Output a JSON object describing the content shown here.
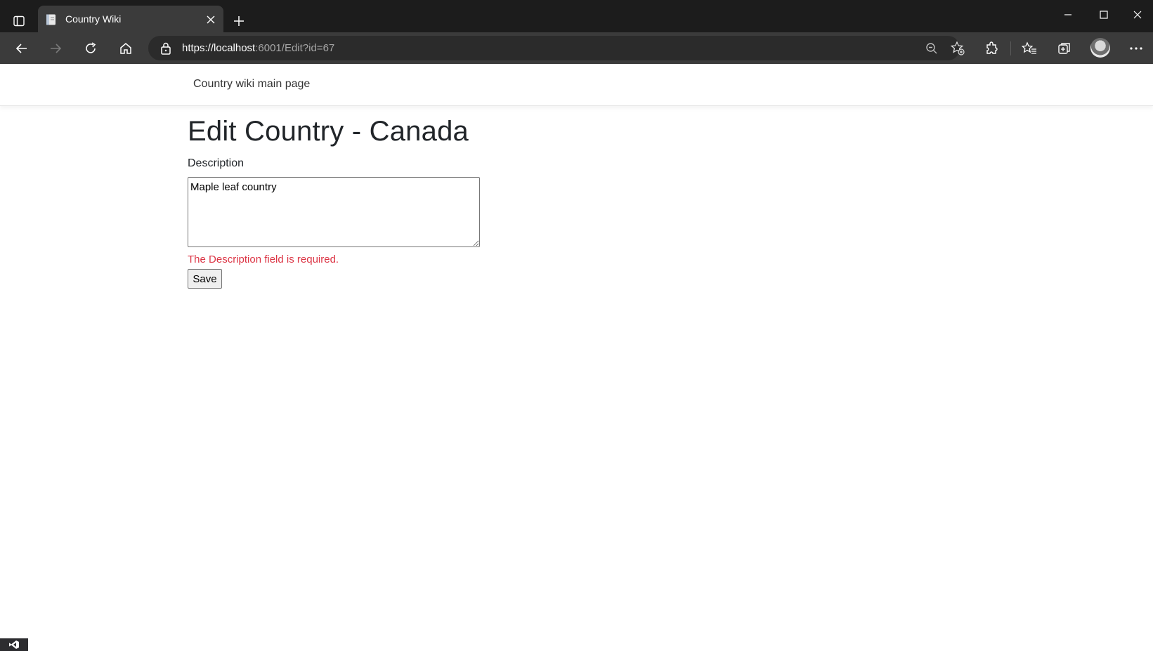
{
  "browser": {
    "tab_title": "Country Wiki",
    "url_host": "https://localhost",
    "url_rest": ":6001/Edit?id=67",
    "icons": [
      "sidebar-toggle-icon",
      "tab-favicon-icon",
      "close-icon",
      "plus-icon",
      "minimize-icon",
      "maximize-icon",
      "window-close-icon",
      "back-arrow-icon",
      "forward-arrow-icon",
      "refresh-icon",
      "home-icon",
      "lock-icon",
      "zoom-out-icon",
      "favorite-add-icon",
      "extensions-icon",
      "favorites-icon",
      "collections-icon",
      "profile-avatar",
      "more-icon"
    ],
    "colors": {
      "titlebar": "#1c1c1c",
      "toolbar": "#3b3b3b",
      "addressbar": "#2b2b2b"
    }
  },
  "site": {
    "brand": "Country wiki main page"
  },
  "form": {
    "title": "Edit Country - Canada",
    "description_label": "Description",
    "description_value": "Maple leaf country",
    "validation_message": "The Description field is required.",
    "save_label": "Save",
    "validation_color": "#dc3545"
  }
}
